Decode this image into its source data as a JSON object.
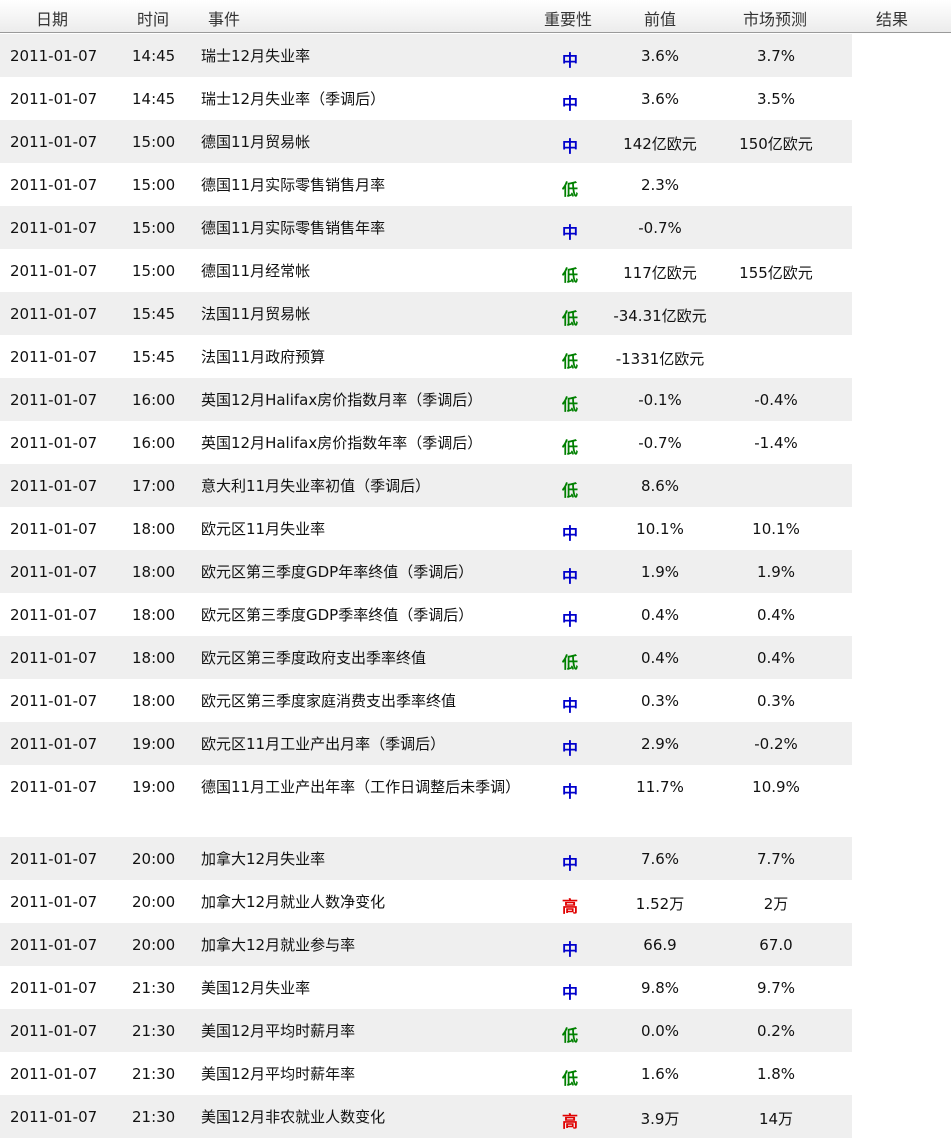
{
  "header": {
    "date": "日期",
    "time": "时间",
    "event": "事件",
    "importance": "重要性",
    "previous": "前值",
    "forecast": "市场预测",
    "result": "结果"
  },
  "colors": {
    "高": "#e00000",
    "中": "#0000cc",
    "低": "#008000"
  },
  "rows": [
    {
      "date": "2011-01-07",
      "time": "14:45",
      "event": "瑞士12月失业率",
      "importance": "中",
      "previous": "3.6%",
      "forecast": "3.7%"
    },
    {
      "date": "2011-01-07",
      "time": "14:45",
      "event": "瑞士12月失业率（季调后）",
      "importance": "中",
      "previous": "3.6%",
      "forecast": "3.5%"
    },
    {
      "date": "2011-01-07",
      "time": "15:00",
      "event": "德国11月贸易帐",
      "importance": "中",
      "previous": "142亿欧元",
      "forecast": "150亿欧元"
    },
    {
      "date": "2011-01-07",
      "time": "15:00",
      "event": "德国11月实际零售销售月率",
      "importance": "低",
      "previous": "2.3%",
      "forecast": ""
    },
    {
      "date": "2011-01-07",
      "time": "15:00",
      "event": "德国11月实际零售销售年率",
      "importance": "中",
      "previous": "-0.7%",
      "forecast": ""
    },
    {
      "date": "2011-01-07",
      "time": "15:00",
      "event": "德国11月经常帐",
      "importance": "低",
      "previous": "117亿欧元",
      "forecast": "155亿欧元"
    },
    {
      "date": "2011-01-07",
      "time": "15:45",
      "event": "法国11月贸易帐",
      "importance": "低",
      "previous": "-34.31亿欧元",
      "forecast": ""
    },
    {
      "date": "2011-01-07",
      "time": "15:45",
      "event": "法国11月政府预算",
      "importance": "低",
      "previous": "-1331亿欧元",
      "forecast": ""
    },
    {
      "date": "2011-01-07",
      "time": "16:00",
      "event": "英国12月Halifax房价指数月率（季调后）",
      "importance": "低",
      "previous": "-0.1%",
      "forecast": "-0.4%"
    },
    {
      "date": "2011-01-07",
      "time": "16:00",
      "event": "英国12月Halifax房价指数年率（季调后）",
      "importance": "低",
      "previous": "-0.7%",
      "forecast": "-1.4%"
    },
    {
      "date": "2011-01-07",
      "time": "17:00",
      "event": "意大利11月失业率初值（季调后）",
      "importance": "低",
      "previous": "8.6%",
      "forecast": ""
    },
    {
      "date": "2011-01-07",
      "time": "18:00",
      "event": "欧元区11月失业率",
      "importance": "中",
      "previous": "10.1%",
      "forecast": "10.1%"
    },
    {
      "date": "2011-01-07",
      "time": "18:00",
      "event": "欧元区第三季度GDP年率终值（季调后）",
      "importance": "中",
      "previous": "1.9%",
      "forecast": "1.9%"
    },
    {
      "date": "2011-01-07",
      "time": "18:00",
      "event": "欧元区第三季度GDP季率终值（季调后）",
      "importance": "中",
      "previous": "0.4%",
      "forecast": "0.4%"
    },
    {
      "date": "2011-01-07",
      "time": "18:00",
      "event": "欧元区第三季度政府支出季率终值",
      "importance": "低",
      "previous": "0.4%",
      "forecast": "0.4%"
    },
    {
      "date": "2011-01-07",
      "time": "18:00",
      "event": "欧元区第三季度家庭消费支出季率终值",
      "importance": "中",
      "previous": "0.3%",
      "forecast": "0.3%"
    },
    {
      "date": "2011-01-07",
      "time": "19:00",
      "event": "欧元区11月工业产出月率（季调后）",
      "importance": "中",
      "previous": "2.9%",
      "forecast": "-0.2%"
    },
    {
      "date": "2011-01-07",
      "time": "19:00",
      "event": "德国11月工业产出年率（工作日调整后未季调）",
      "importance": "中",
      "previous": "11.7%",
      "forecast": "10.9%"
    },
    {
      "date": "2011-01-07",
      "time": "20:00",
      "event": "加拿大12月失业率",
      "importance": "中",
      "previous": "7.6%",
      "forecast": "7.7%"
    },
    {
      "date": "2011-01-07",
      "time": "20:00",
      "event": "加拿大12月就业人数净变化",
      "importance": "高",
      "previous": "1.52万",
      "forecast": "2万"
    },
    {
      "date": "2011-01-07",
      "time": "20:00",
      "event": "加拿大12月就业参与率",
      "importance": "中",
      "previous": "66.9",
      "forecast": "67.0"
    },
    {
      "date": "2011-01-07",
      "time": "21:30",
      "event": "美国12月失业率",
      "importance": "中",
      "previous": "9.8%",
      "forecast": "9.7%"
    },
    {
      "date": "2011-01-07",
      "time": "21:30",
      "event": "美国12月平均时薪月率",
      "importance": "低",
      "previous": "0.0%",
      "forecast": "0.2%"
    },
    {
      "date": "2011-01-07",
      "time": "21:30",
      "event": "美国12月平均时薪年率",
      "importance": "低",
      "previous": "1.6%",
      "forecast": "1.8%"
    },
    {
      "date": "2011-01-07",
      "time": "21:30",
      "event": "美国12月非农就业人数变化",
      "importance": "高",
      "previous": "3.9万",
      "forecast": "14万"
    }
  ]
}
